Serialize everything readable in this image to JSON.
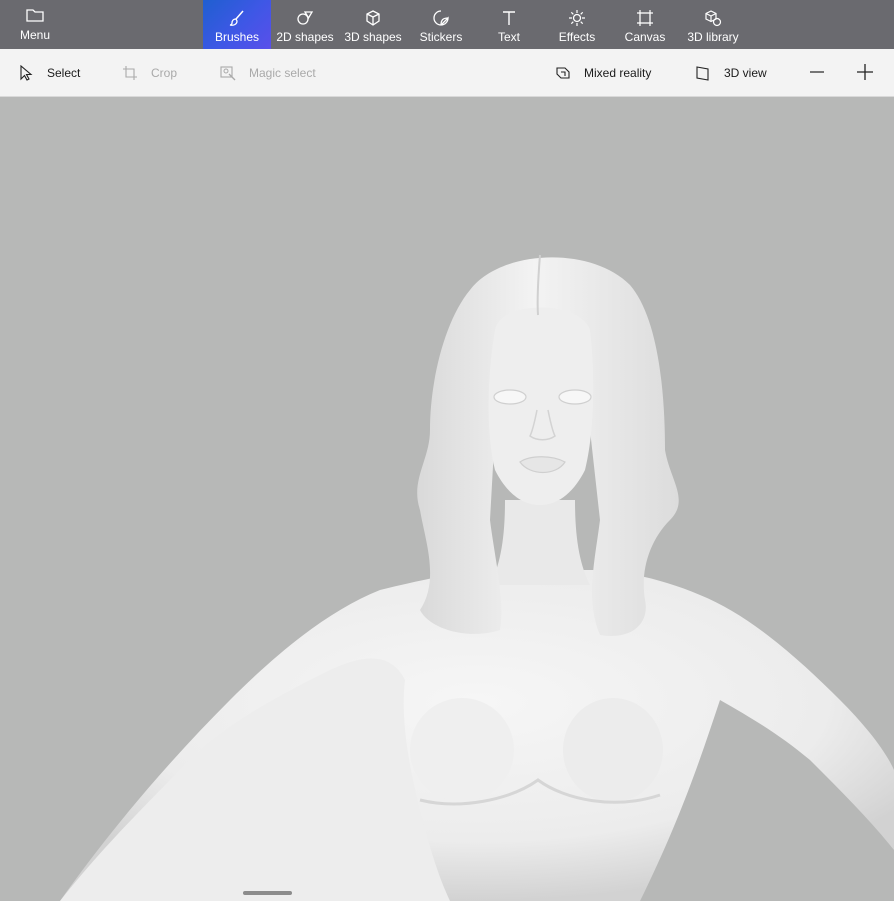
{
  "menu": {
    "label": "Menu",
    "icon": "folder-icon"
  },
  "tabs": [
    {
      "label": "Brushes",
      "icon": "brush-icon",
      "active": true
    },
    {
      "label": "2D shapes",
      "icon": "shapes-2d-icon"
    },
    {
      "label": "3D shapes",
      "icon": "cube-icon"
    },
    {
      "label": "Stickers",
      "icon": "sticker-icon"
    },
    {
      "label": "Text",
      "icon": "text-icon"
    },
    {
      "label": "Effects",
      "icon": "sun-icon"
    },
    {
      "label": "Canvas",
      "icon": "canvas-icon"
    },
    {
      "label": "3D library",
      "icon": "library-icon"
    }
  ],
  "toolbar": {
    "select": "Select",
    "crop": "Crop",
    "magic_select": "Magic select",
    "mixed_reality": "Mixed reality",
    "view_3d": "3D view"
  },
  "colors": {
    "ribbon": "#6a6a6f",
    "active_tab": "#3f57e6",
    "canvas_bg": "#b7b8b7",
    "model": "#ececec"
  }
}
